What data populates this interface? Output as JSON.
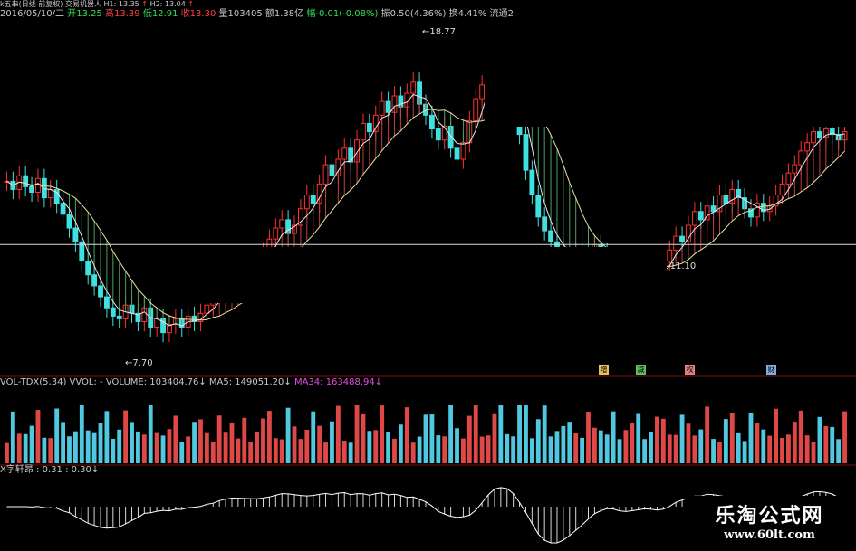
{
  "header": {
    "indicator_name": "k五串(日线 前复权)",
    "indicator_suffix": "交易机器人",
    "h1": "H1: 13.35",
    "h2": "H2: 13.04",
    "arrow": "↑",
    "date": "2016/05/10/二",
    "open_label": "开13.25",
    "high_label": "高13.39",
    "low_label": "低12.91",
    "close_label": "收13.30",
    "volume_label": "量103405",
    "amount_label": "额1.38亿",
    "change_label": "幅-0.01(-0.08%)",
    "amplitude_label": "振0.50(4.36%)",
    "turnover_label": "换4.41%",
    "float_label": "流通2."
  },
  "volume_header": {
    "name": "VOL-TDX(5,34)",
    "vvol": "VVOL: -",
    "volume": "VOLUME: 103404.76↓",
    "ma5": "MA5: 149051.20↓",
    "ma34": "MA34: 163488.94↓"
  },
  "macd_header": {
    "name": "X字轩昂",
    "v1": ": 0.31",
    "v2": ": 0.30↓"
  },
  "price_labels": {
    "high": "18.77",
    "low": "7.70",
    "marker": "11.10"
  },
  "events": [
    {
      "label": "增",
      "color": "#e8c060"
    },
    {
      "label": "减",
      "color": "#60c060"
    },
    {
      "label": "权",
      "color": "#e08080"
    },
    {
      "label": "财",
      "color": "#80b0e0"
    }
  ],
  "watermark": {
    "cn": "乐淘公式网",
    "url": "www.60lt.com"
  },
  "chart_data": {
    "type": "candlestick",
    "title": "",
    "ylim": [
      7.0,
      19.0
    ],
    "reference_lines": [
      11.1
    ],
    "annotations": [
      {
        "label": "18.77",
        "kind": "high"
      },
      {
        "label": "7.70",
        "kind": "low"
      },
      {
        "label": "11.10",
        "kind": "line"
      }
    ],
    "close": [
      13.4,
      13.1,
      13.6,
      13.2,
      13.0,
      13.5,
      12.8,
      13.1,
      12.6,
      12.2,
      11.7,
      11.2,
      10.5,
      10.0,
      9.6,
      9.2,
      8.8,
      8.5,
      8.4,
      8.9,
      8.6,
      8.3,
      8.8,
      8.1,
      8.4,
      7.9,
      8.2,
      8.4,
      8.1,
      8.5,
      8.3,
      8.6,
      8.9,
      9.2,
      9.4,
      9.6,
      9.7,
      9.8,
      9.9,
      10.1,
      10.4,
      10.8,
      11.3,
      11.7,
      12.0,
      11.5,
      11.8,
      12.4,
      12.9,
      12.6,
      13.3,
      14.0,
      13.6,
      14.2,
      14.6,
      14.1,
      14.9,
      15.5,
      15.2,
      15.8,
      16.3,
      15.9,
      16.5,
      16.1,
      16.6,
      17.0,
      16.2,
      15.8,
      15.3,
      14.9,
      15.4,
      14.6,
      14.2,
      14.8,
      15.6,
      16.4,
      16.9,
      17.8,
      18.3,
      17.5,
      17.2,
      16.6,
      15.1,
      13.8,
      12.9,
      12.1,
      11.6,
      11.2,
      10.9,
      10.7,
      10.6,
      10.8,
      10.5,
      10.9,
      11.1,
      10.8,
      10.4,
      10.1,
      9.9,
      10.2,
      10.6,
      10.3,
      10.0,
      9.8,
      10.1,
      10.5,
      10.9,
      11.4,
      11.2,
      11.8,
      12.3,
      12.0,
      12.5,
      12.3,
      12.9,
      12.6,
      13.1,
      12.8,
      12.4,
      12.1,
      12.6,
      12.3,
      12.5,
      12.9,
      13.3,
      13.7,
      14.0,
      14.5,
      14.8,
      15.2,
      15.0,
      15.3,
      15.1,
      14.9,
      15.2
    ]
  }
}
